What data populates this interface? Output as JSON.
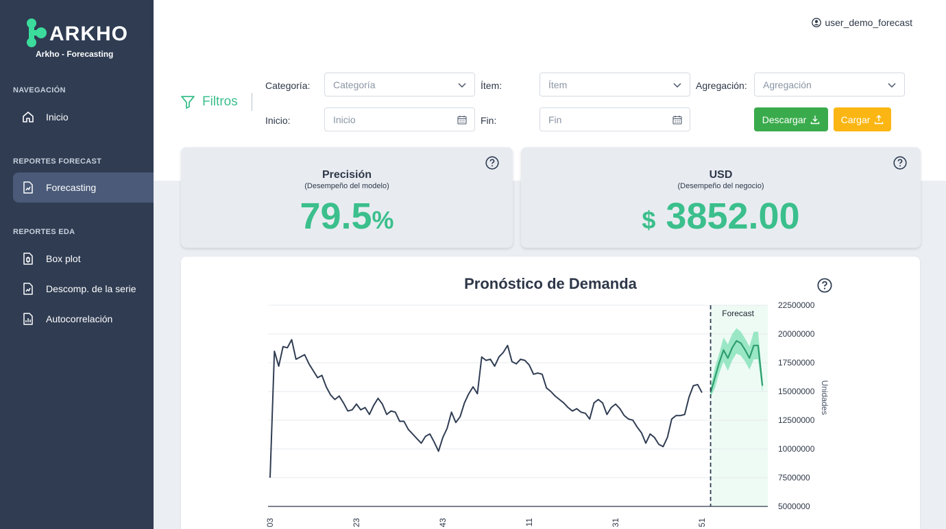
{
  "app": {
    "brand": "ARKHO",
    "subtitle": "Arkho - Forecasting"
  },
  "sidebar": {
    "sections": [
      {
        "title": "NAVEGACIÓN",
        "items": [
          {
            "label": "Inicio",
            "icon": "home-icon"
          }
        ]
      },
      {
        "title": "REPORTES FORECAST",
        "items": [
          {
            "label": "Forecasting",
            "icon": "chart-file-icon",
            "active": true
          }
        ]
      },
      {
        "title": "REPORTES EDA",
        "items": [
          {
            "label": "Box plot",
            "icon": "boxplot-file-icon"
          },
          {
            "label": "Descomp. de la serie",
            "icon": "chart-file-icon"
          },
          {
            "label": "Autocorrelación",
            "icon": "bar-file-icon"
          }
        ]
      }
    ]
  },
  "header": {
    "username": "user_demo_forecast"
  },
  "filters": {
    "title": "Filtros",
    "categoria_label": "Categoría:",
    "categoria_placeholder": "Categoría",
    "item_label": "Ítem:",
    "item_placeholder": "Ítem",
    "agregacion_label": "Agregación:",
    "agregacion_placeholder": "Agregación",
    "inicio_label": "Inicio:",
    "inicio_placeholder": "Inicio",
    "fin_label": "Fin:",
    "fin_placeholder": "Fin",
    "download_label": "Descargar",
    "upload_label": "Cargar"
  },
  "kpis": {
    "precision": {
      "title": "Precisión",
      "subtitle": "(Desempeño del modelo)",
      "value": "79.5",
      "unit": "%"
    },
    "usd": {
      "title": "USD",
      "subtitle": "(Desempeño del negocio)",
      "currency": "$",
      "value": "3852.00"
    }
  },
  "colors": {
    "accent": "#3bbf8c",
    "sidebar": "#2f3c52",
    "download": "#3aab4c",
    "upload": "#fbb613",
    "series": "#2f3c52",
    "forecast": "#2e9e6e"
  },
  "chart_data": {
    "type": "line",
    "title": "Pronóstico de Demanda",
    "ylabel": "Unidades",
    "ylim": [
      5000000,
      22500000
    ],
    "yticks": [
      5000000,
      7500000,
      10000000,
      12500000,
      15000000,
      17500000,
      20000000,
      22500000
    ],
    "ytick_labels": [
      "5000000",
      "7500000",
      "10000000",
      "12500000",
      "15000000",
      "17500000",
      "20000000",
      "22500000"
    ],
    "xtick_labels": [
      "03",
      "23",
      "43",
      "11",
      "31",
      "51"
    ],
    "xtick_index": [
      0,
      20,
      40,
      60,
      80,
      100
    ],
    "annotation": "Forecast",
    "forecast_start_index": 102,
    "history": [
      7500000,
      18500000,
      17200000,
      18900000,
      18800000,
      19500000,
      17800000,
      18000000,
      18200000,
      17400000,
      16800000,
      16200000,
      16400000,
      15400000,
      14700000,
      14300000,
      14600000,
      14000000,
      13300000,
      13400000,
      13900000,
      13400000,
      13600000,
      13000000,
      13800000,
      14400000,
      13900000,
      13000000,
      13300000,
      13200000,
      12400000,
      12400000,
      11700000,
      11300000,
      10900000,
      10500000,
      11100000,
      11300000,
      10600000,
      9800000,
      11000000,
      11800000,
      13200000,
      12300000,
      12800000,
      14000000,
      14800000,
      15400000,
      14800000,
      18000000,
      17700000,
      17800000,
      17200000,
      18000000,
      18400000,
      19000000,
      17600000,
      17400000,
      17800000,
      17700000,
      17300000,
      16500000,
      16600000,
      16500000,
      15300000,
      15000000,
      14600000,
      14300000,
      14000000,
      13600000,
      13300000,
      13500000,
      13200000,
      13100000,
      12600000,
      14000000,
      14300000,
      14000000,
      13000000,
      13600000,
      13900000,
      13500000,
      12900000,
      12600000,
      12500000,
      11900000,
      11400000,
      10500000,
      11300000,
      11000000,
      10400000,
      10200000,
      11000000,
      12600000,
      12900000,
      12900000,
      13000000,
      14500000,
      15500000,
      15600000,
      14900000
    ],
    "forecast": [
      14900000,
      16200000,
      17500000,
      18600000,
      17900000,
      18800000,
      19400000,
      19200000,
      18600000,
      17900000,
      19000000,
      19000000,
      15500000
    ],
    "forecast_upper": [
      15300000,
      17100000,
      18300000,
      19700000,
      19100000,
      20000000,
      20500000,
      20200000,
      19600000,
      18900000,
      20200000,
      20200000,
      16100000
    ],
    "forecast_lower": [
      14500000,
      15300000,
      16600000,
      17600000,
      16800000,
      17700000,
      18300000,
      18100000,
      17600000,
      16900000,
      17800000,
      17800000,
      14900000
    ]
  }
}
